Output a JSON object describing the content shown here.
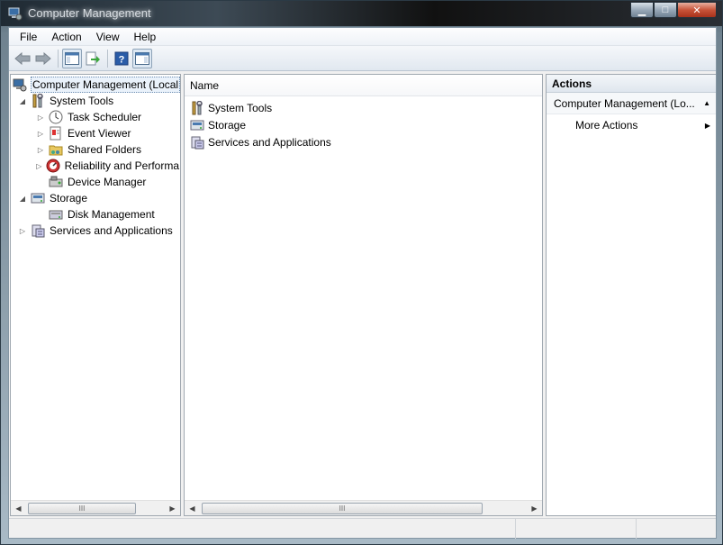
{
  "window": {
    "title": "Computer Management"
  },
  "menu": [
    "File",
    "Action",
    "View",
    "Help"
  ],
  "toolbar": {
    "buttons": [
      "back-arrow-icon",
      "forward-arrow-icon",
      "show-hide-console-tree-icon",
      "export-list-icon",
      "help-icon",
      "show-hide-action-pane-icon"
    ]
  },
  "tree": {
    "root": "Computer Management (Local",
    "items": [
      {
        "label": "System Tools",
        "level": 1,
        "expanded": true
      },
      {
        "label": "Task Scheduler",
        "level": 2,
        "expandable": true
      },
      {
        "label": "Event Viewer",
        "level": 2,
        "expandable": true
      },
      {
        "label": "Shared Folders",
        "level": 2,
        "expandable": true
      },
      {
        "label": "Reliability and Performa",
        "level": 2,
        "expandable": true
      },
      {
        "label": "Device Manager",
        "level": 2,
        "expandable": false
      },
      {
        "label": "Storage",
        "level": 1,
        "expanded": true
      },
      {
        "label": "Disk Management",
        "level": 2,
        "expandable": false
      },
      {
        "label": "Services and Applications",
        "level": 1,
        "expanded": false
      }
    ]
  },
  "list": {
    "column": "Name",
    "rows": [
      "System Tools",
      "Storage",
      "Services and Applications"
    ]
  },
  "actions": {
    "header": "Actions",
    "section": "Computer Management (Lo...",
    "items": [
      "More Actions"
    ]
  },
  "scroll_grip": "III",
  "colors": {
    "accent": "#6b8cb0",
    "title_bg": "#1f2a33"
  }
}
